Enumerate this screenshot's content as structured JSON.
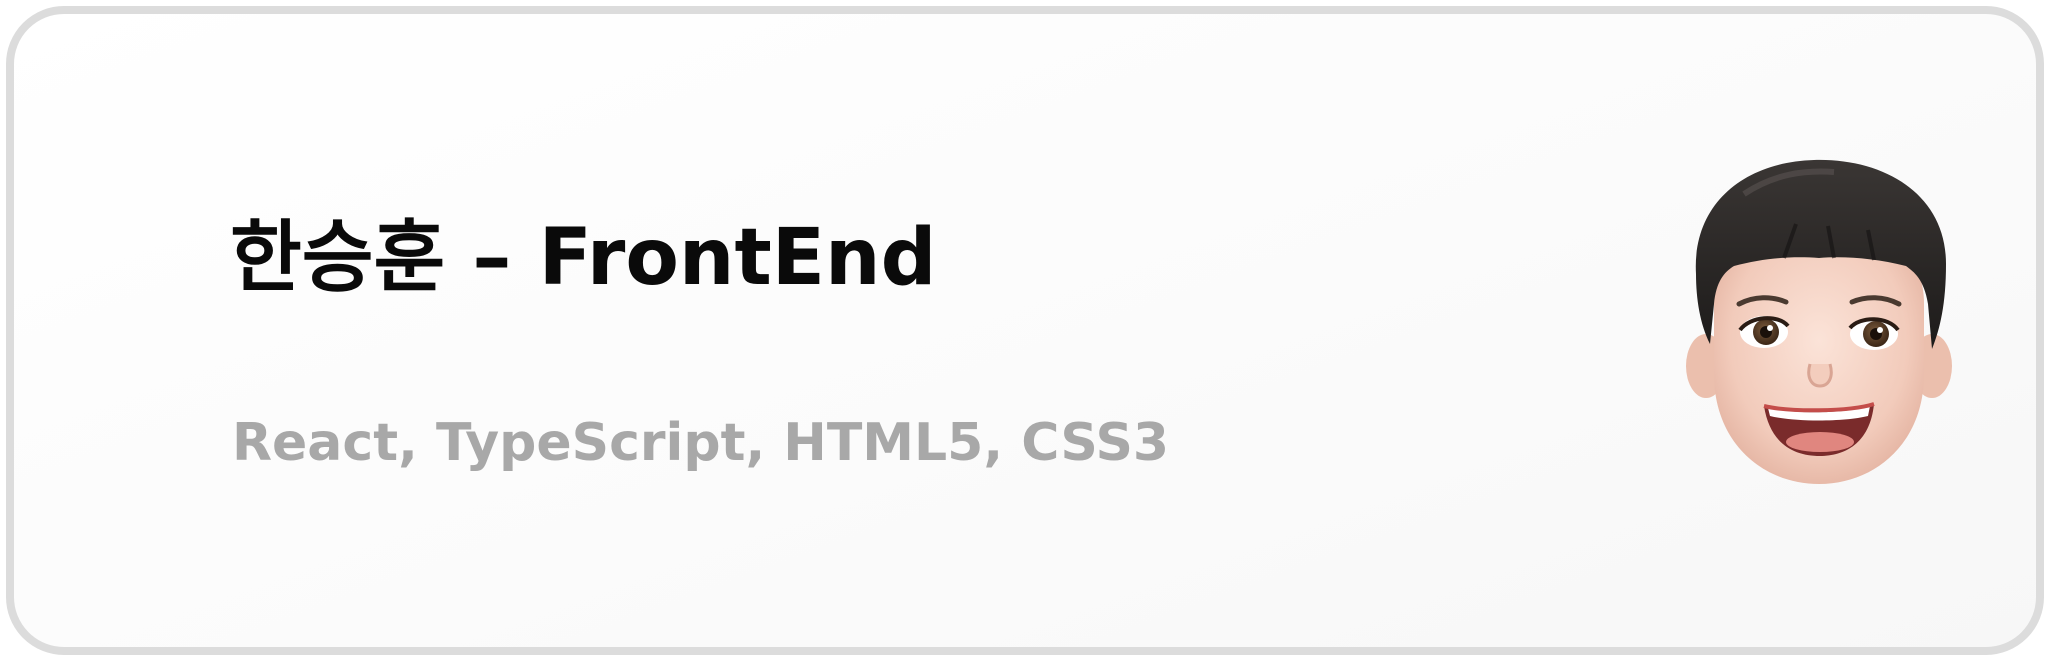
{
  "profile": {
    "name_title": "한승훈 – FrontEnd",
    "skills": "React, TypeScript, HTML5, CSS3"
  },
  "colors": {
    "title": "#0a0a0a",
    "subtitle": "#a8a8a8",
    "card_border": "#dcdcdc",
    "card_background": "#ffffff"
  },
  "avatar": {
    "icon": "memoji-avatar-icon"
  }
}
